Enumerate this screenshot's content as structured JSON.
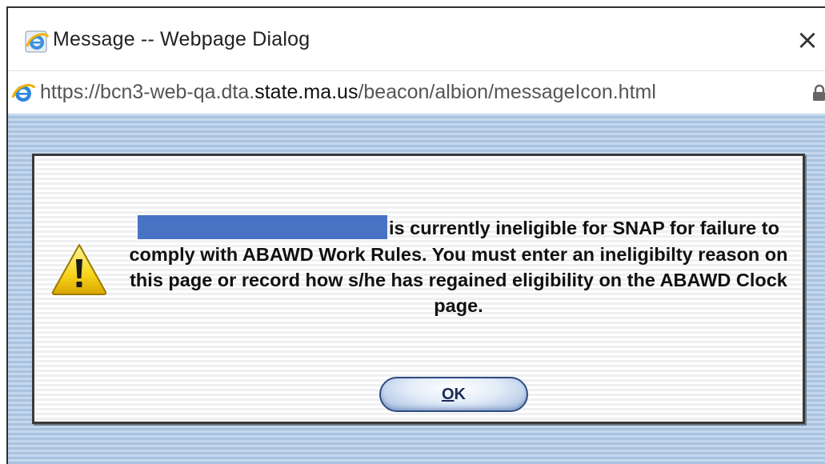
{
  "window": {
    "title": "Message -- Webpage Dialog",
    "close_glyph": "×",
    "icon": "ie-icon"
  },
  "address_bar": {
    "url_prefix": "https://bcn3-web-qa.dta.",
    "url_host": "state.ma.us",
    "url_path": "/beacon/albion/messageIcon.html",
    "icons": [
      "ie-icon",
      "lock-icon"
    ]
  },
  "message": {
    "icon": "warning-icon",
    "text": "is currently ineligible for SNAP for failure to comply with ABAWD Work Rules. You must enter an ineligibilty reason on this page or record how s/he has regained eligibility on the ABAWD Clock page.",
    "redaction_color": "#4873c4"
  },
  "ok_button": {
    "mnemonic": "O",
    "rest": "K"
  },
  "colors": {
    "stripe_light": "#c4d7ec",
    "stripe_dark": "#a9c2df",
    "button_border": "#2f4b82"
  }
}
